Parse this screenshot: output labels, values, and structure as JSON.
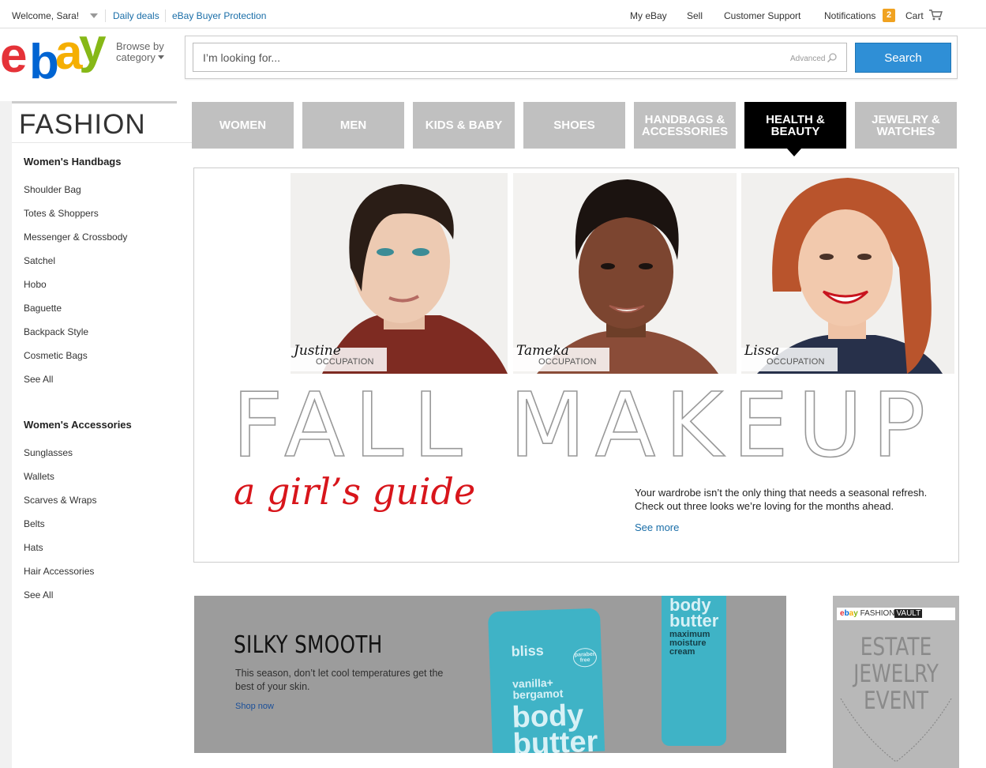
{
  "topbar": {
    "welcome": "Welcome, Sara!",
    "daily_deals": "Daily deals",
    "buyer_protection": "eBay Buyer Protection",
    "my_ebay": "My eBay",
    "sell": "Sell",
    "customer_support": "Customer Support",
    "notifications": "Notifications",
    "notifications_count": "2",
    "cart": "Cart"
  },
  "header": {
    "logo_letters": [
      "e",
      "b",
      "a",
      "y"
    ],
    "logo_colors": [
      "#e53238",
      "#0064d2",
      "#f5af02",
      "#86b817"
    ],
    "browse_line1": "Browse by",
    "browse_line2": "category",
    "search_placeholder": "I’m looking for...",
    "advanced": "Advanced",
    "search_button": "Search"
  },
  "sidebar": {
    "title": "FASHION",
    "sections": [
      {
        "heading": "Women's Handbags",
        "items": [
          "Shoulder Bag",
          "Totes & Shoppers",
          "Messenger & Crossbody",
          "Satchel",
          "Hobo",
          "Baguette",
          "Backpack Style",
          "Cosmetic Bags",
          "See All"
        ]
      },
      {
        "heading": "Women's Accessories",
        "items": [
          "Sunglasses",
          "Wallets",
          "Scarves & Wraps",
          "Belts",
          "Hats",
          "Hair Accessories",
          "See All"
        ]
      }
    ]
  },
  "nav": {
    "tabs": [
      {
        "label": "WOMEN",
        "active": false
      },
      {
        "label": "MEN",
        "active": false
      },
      {
        "label": "KIDS & BABY",
        "active": false
      },
      {
        "label": "SHOES",
        "active": false
      },
      {
        "label": "HANDBAGS & ACCESSORIES",
        "active": false
      },
      {
        "label": "HEALTH & BEAUTY",
        "active": true
      },
      {
        "label": "JEWELRY & WATCHES",
        "active": false
      }
    ]
  },
  "hero": {
    "models": [
      {
        "name": "Justine",
        "occupation": "OCCUPATION"
      },
      {
        "name": "Tameka",
        "occupation": "OCCUPATION"
      },
      {
        "name": "Lissa",
        "occupation": "OCCUPATION"
      }
    ],
    "title": "FALL MAKEUP",
    "script_subtitle": "a girl’s guide",
    "description": "Your wardrobe isn’t the only thing that needs a seasonal refresh. Check out three looks we’re loving for the months ahead.",
    "see_more": "See more"
  },
  "promo": {
    "title": "SILKY SMOOTH",
    "text": "This season, don’t let cool temperatures get the best of your skin.",
    "shop_now": "Shop now",
    "tube1_brand": "bliss",
    "tube1_badge": "paraben free",
    "tube1_flavor": "vanilla+ bergamot",
    "tube1_product": "body butter",
    "tube2_product": "body butter",
    "tube2_desc": "maximum moisture cream"
  },
  "side_ad": {
    "brand_prefix": "FASHION",
    "brand_word": "VAULT",
    "headline": "ESTATE JEWELRY EVENT"
  },
  "colors": {
    "link": "#1a6ea8",
    "search_button": "#2f8fd6",
    "tab_inactive": "#c0c0c0",
    "tab_active": "#000000",
    "script_red": "#d8151b",
    "notification_badge": "#f0a220"
  }
}
